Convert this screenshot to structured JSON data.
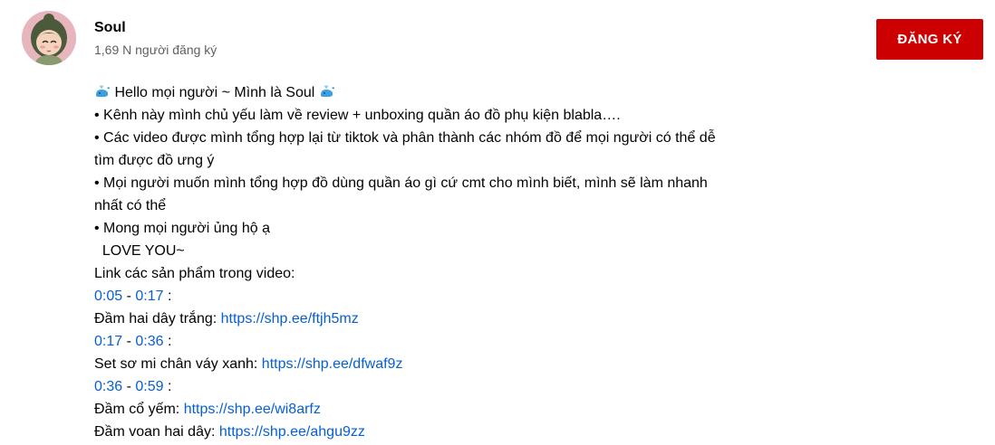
{
  "channel": {
    "name": "Soul",
    "subscribers": "1,69 N người đăng ký",
    "subscribe_label": "ĐĂNG KÝ"
  },
  "description": {
    "greeting": {
      "icon": "whale-emoji-icon",
      "text": " Hello mọi người ~ Mình là Soul "
    },
    "lines": [
      "• Kênh này mình chủ yếu làm về review + unboxing quần áo đồ phụ kiện blabla….",
      "• Các video được mình tổng hợp lại từ tiktok và phân thành các nhóm đồ để mọi người có thể dễ",
      "tìm được đồ ưng ý",
      "• Mọi người muốn mình tổng hợp đồ dùng quần áo gì cứ cmt cho mình biết, mình sẽ làm nhanh",
      "nhất có thể",
      "• Mong mọi người ủng hộ ạ",
      "  LOVE YOU~",
      "Link các sản phẩm trong video:"
    ],
    "products": [
      {
        "start": "0:05",
        "end": "0:17",
        "name": "Đầm hai dây trắng: ",
        "url": "https://shp.ee/ftjh5mz"
      },
      {
        "start": "0:17",
        "end": "0:36",
        "name": "Set sơ mi chân váy xanh: ",
        "url": "https://shp.ee/dfwaf9z"
      },
      {
        "start": "0:36",
        "end": "0:59",
        "name": "Đầm cổ yếm: ",
        "url": "https://shp.ee/wi8arfz"
      }
    ],
    "last_product": {
      "name": "Đầm voan hai dây: ",
      "url": "https://shp.ee/ahgu9zz"
    },
    "sep": " - ",
    "colon": " :"
  },
  "colors": {
    "subscribe": "#cc0000",
    "link": "#065fd4",
    "secondary_text": "#606060"
  }
}
